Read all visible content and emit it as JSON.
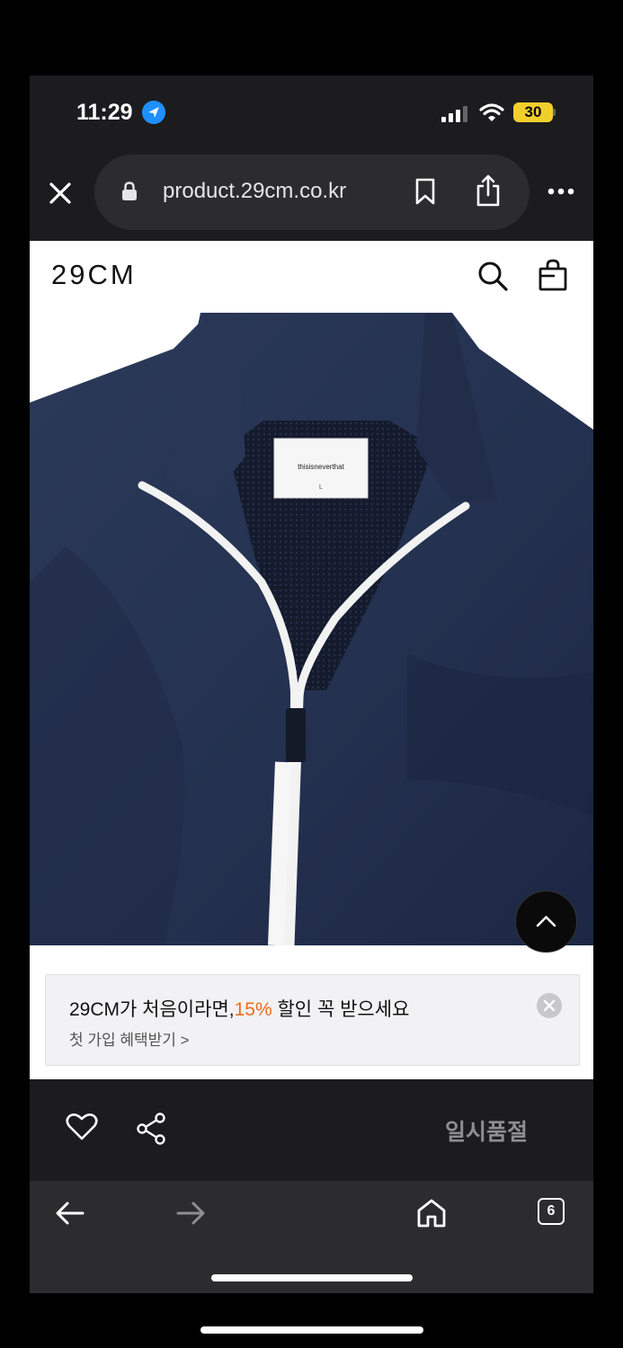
{
  "status_bar": {
    "time": "11:29",
    "battery": "30",
    "icons": [
      "location-icon",
      "signal-icon",
      "wifi-icon",
      "battery-icon"
    ]
  },
  "browser": {
    "url": "product.29cm.co.kr",
    "tab_count": "6",
    "icons": [
      "close-icon",
      "lock-icon",
      "bookmark-icon",
      "share-icon",
      "more-icon",
      "back-icon",
      "forward-icon",
      "home-icon",
      "tabs-icon"
    ]
  },
  "site": {
    "logo": "29CM",
    "icons": [
      "search-icon",
      "shopping-bag-icon"
    ]
  },
  "product_image": {
    "label_brand": "thisisneverthat",
    "label_size": "L",
    "colors": {
      "jacket": "#283552",
      "jacket_dark": "#1b2540",
      "zipper": "#f4f4f4"
    }
  },
  "banner": {
    "title_pre": "29CM가 처음이라면,",
    "title_pct": "15%",
    "title_post": " 할인 꼭 받으세요",
    "subtitle": "첫 가입 혜택받기 >",
    "accent": "#ef6a1c"
  },
  "action_bar": {
    "status_text": "일시품절",
    "icons": [
      "heart-icon",
      "share-node-icon"
    ]
  }
}
